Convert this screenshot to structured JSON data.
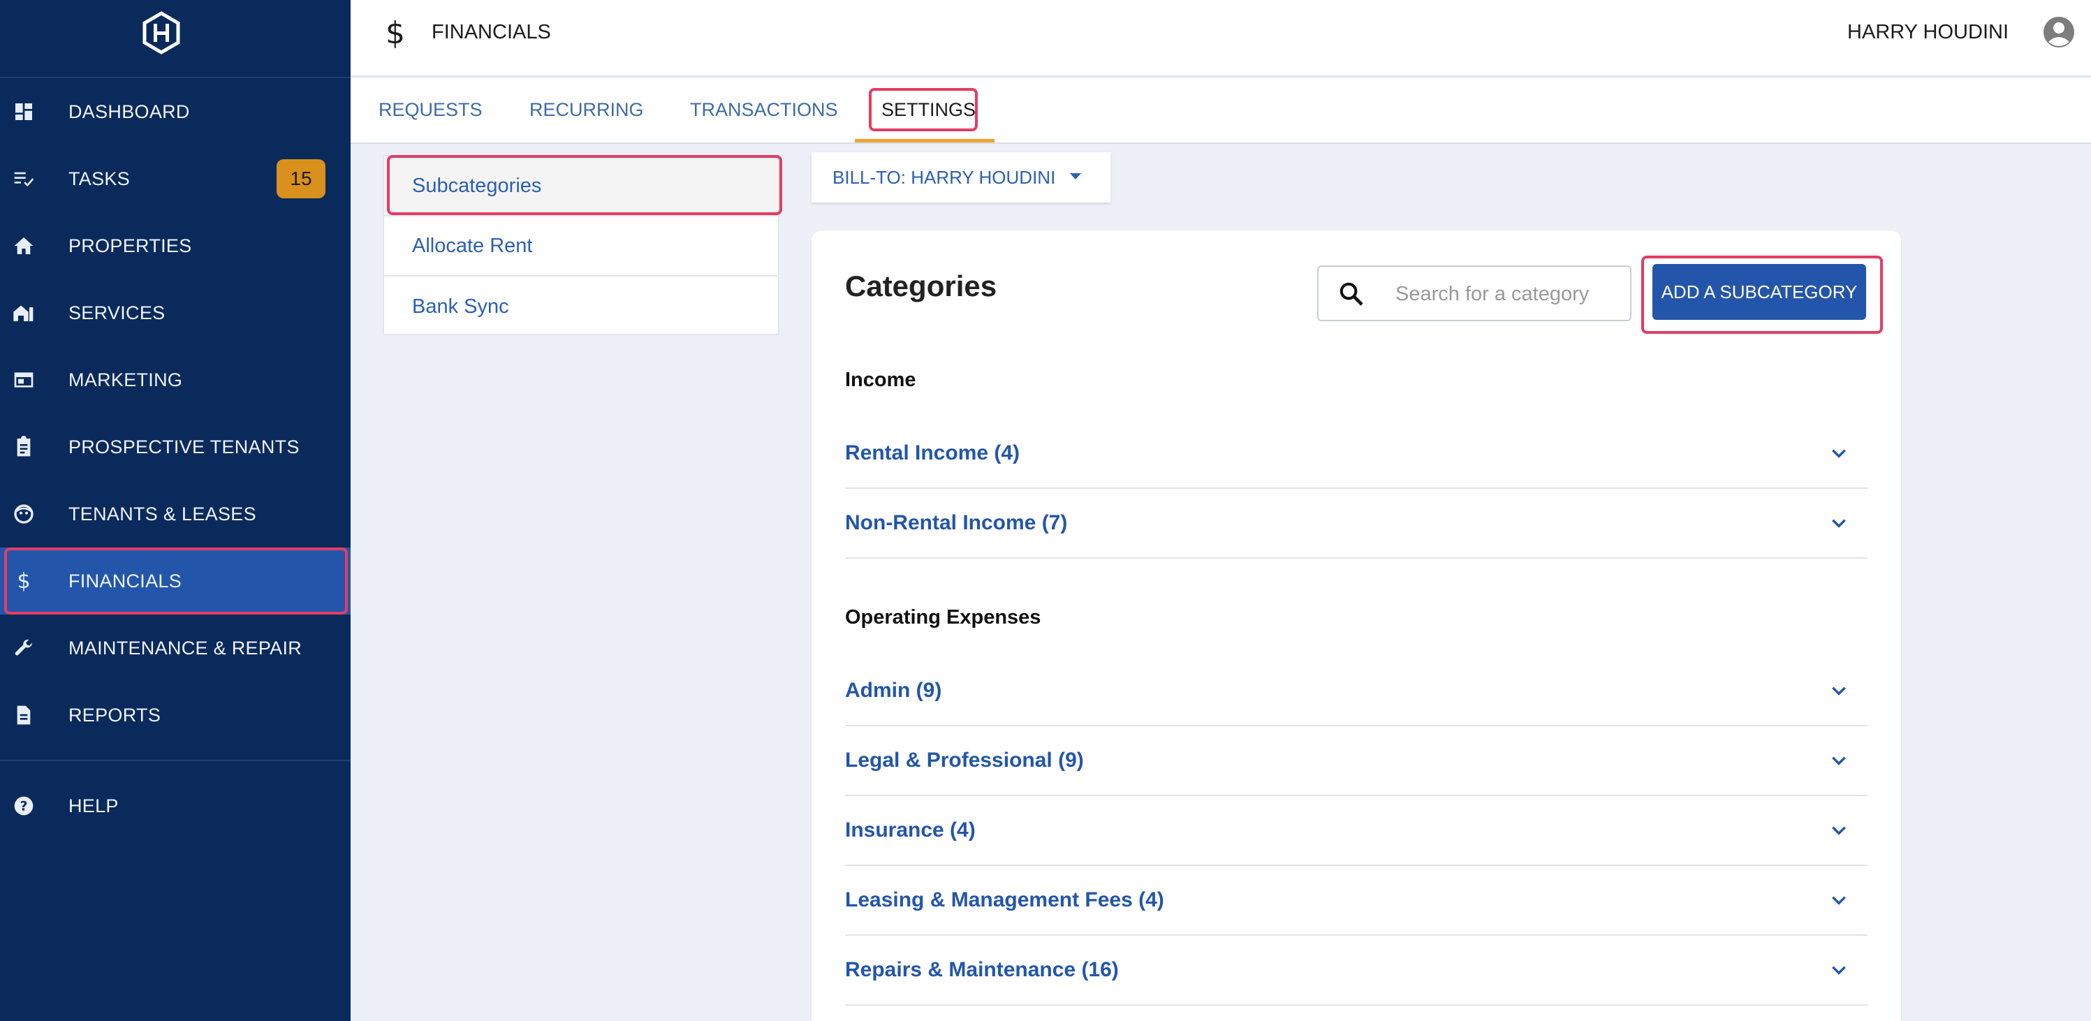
{
  "sidebar": {
    "items": [
      {
        "label": "DASHBOARD",
        "icon": "dashboard-icon"
      },
      {
        "label": "TASKS",
        "icon": "tasks-icon",
        "badge": "15"
      },
      {
        "label": "PROPERTIES",
        "icon": "home-icon"
      },
      {
        "label": "SERVICES",
        "icon": "services-icon"
      },
      {
        "label": "MARKETING",
        "icon": "marketing-icon"
      },
      {
        "label": "PROSPECTIVE TENANTS",
        "icon": "clipboard-icon"
      },
      {
        "label": "TENANTS & LEASES",
        "icon": "tenant-face-icon"
      },
      {
        "label": "FINANCIALS",
        "icon": "dollar-icon"
      },
      {
        "label": "MAINTENANCE & REPAIR",
        "icon": "wrench-icon"
      },
      {
        "label": "REPORTS",
        "icon": "document-icon"
      },
      {
        "label": "HELP",
        "icon": "help-icon"
      }
    ],
    "colors": {
      "background": "#0a2a5c",
      "active": "#2356aa",
      "badge": "#d9901c"
    }
  },
  "header": {
    "icon_glyph": "$",
    "title": "FINANCIALS",
    "user_name": "HARRY HOUDINI"
  },
  "tabs": [
    {
      "label": "REQUESTS"
    },
    {
      "label": "RECURRING"
    },
    {
      "label": "TRANSACTIONS"
    },
    {
      "label": "SETTINGS",
      "active": true
    }
  ],
  "settings_menu": [
    {
      "label": "Subcategories",
      "active": true
    },
    {
      "label": "Allocate Rent"
    },
    {
      "label": "Bank Sync"
    }
  ],
  "bill_to": {
    "label": "BILL-TO: HARRY HOUDINI"
  },
  "categories": {
    "title": "Categories",
    "search_placeholder": "Search for a category",
    "add_button": "ADD A SUBCATEGORY",
    "groups": [
      {
        "label": "Income",
        "rows": [
          "Rental Income (4)",
          "Non-Rental Income (7)"
        ]
      },
      {
        "label": "Operating Expenses",
        "rows": [
          "Admin (9)",
          "Legal & Professional (9)",
          "Insurance (4)",
          "Leasing & Management Fees (4)",
          "Repairs & Maintenance (16)"
        ]
      }
    ]
  },
  "accent_colors": {
    "link": "#2356aa",
    "highlight": "#e43c64",
    "tab_underline": "#f0a431"
  }
}
